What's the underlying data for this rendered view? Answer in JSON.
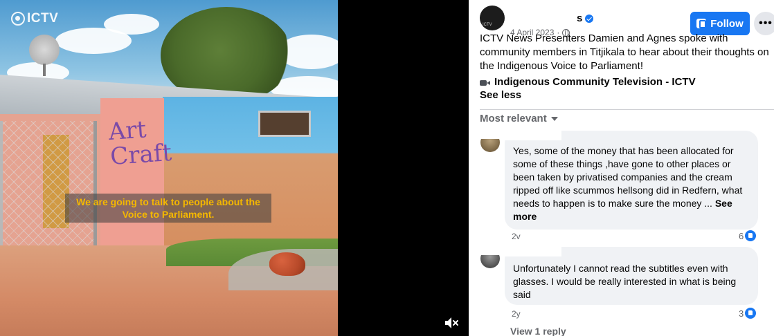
{
  "video": {
    "watermark": "ICTV",
    "mural_text": "Art\nCraft",
    "subtitle": "We are going to talk to people about the Voice to Parliament.",
    "mute_icon": "volume-muted-icon"
  },
  "post": {
    "page_name_visible": "s",
    "date": "4 April 2023",
    "date_separator": "·",
    "privacy_icon": "globe-icon",
    "follow_label": "Follow",
    "more_label": "•••",
    "text": "ICTV News Presenters Damien and Agnes spoke with community members in Titjikala to hear about their thoughts on the Indigenous Voice to Parliament!",
    "page_link_icon": "movie-camera-icon",
    "page_link": "Indigenous Community Television - ICTV",
    "see_less": "See less"
  },
  "comments_header": {
    "sort_label": "Most relevant"
  },
  "comments": [
    {
      "text": "Yes, some of the money that has been allocated for some of these things ,have gone to other places or been taken by privatised companies and the cream ripped off like scummos hellsong did in Redfern, what needs to happen is to make sure the money ...",
      "see_more": "See more",
      "time": "2v",
      "reactions": "6"
    },
    {
      "text": "Unfortunately I cannot read the subtitles even with glasses. I would be really interested in what is being said",
      "time": "2y",
      "reactions": "3",
      "view_replies": "View 1 reply"
    }
  ],
  "colors": {
    "facebook_blue": "#1877f2",
    "subtitle_yellow": "#f5b800",
    "bubble_grey": "#f0f2f5",
    "secondary_text": "#65676b"
  }
}
